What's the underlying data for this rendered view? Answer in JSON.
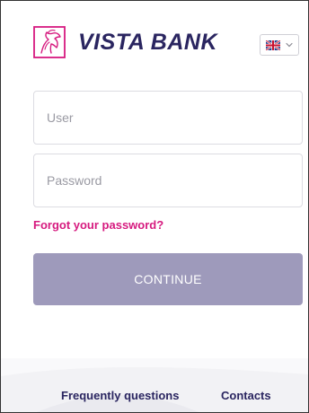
{
  "brand": {
    "name": "VISTA BANK",
    "logo_icon": "horse-logo-icon",
    "primary_color": "#2a2560",
    "accent_color": "#d61a7f"
  },
  "language": {
    "selected": "English",
    "flag_icon": "uk-flag-icon",
    "chevron_icon": "chevron-down-icon"
  },
  "login": {
    "user_placeholder": "User",
    "password_placeholder": "Password",
    "forgot_label": "Forgot your password?",
    "continue_label": "CONTINUE",
    "continue_color": "#9e9abb"
  },
  "footer": {
    "faq_label": "Frequently questions",
    "contacts_label": "Contacts"
  }
}
